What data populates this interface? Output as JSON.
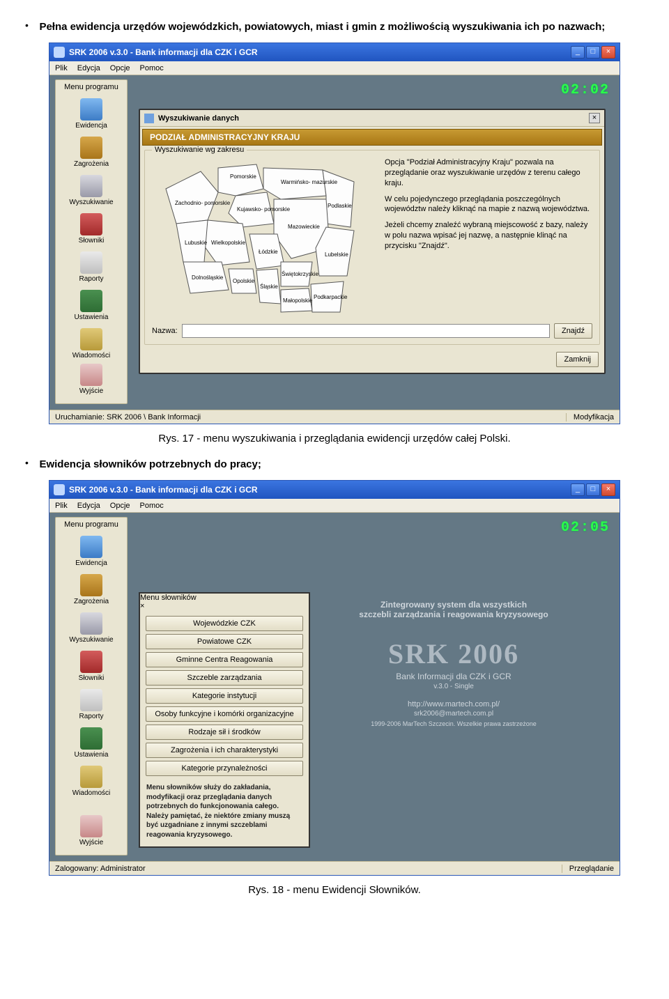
{
  "bullets": {
    "b1": "Pełna ewidencja urzędów wojewódzkich, powiatowych, miast i gmin z możliwością wyszukiwania ich po nazwach;",
    "b2": "Ewidencja słowników potrzebnych do pracy;"
  },
  "captions": {
    "c1": "Rys. 17 - menu wyszukiwania i przeglądania ewidencji urzędów całej Polski.",
    "c2": "Rys. 18 - menu Ewidencji Słowników."
  },
  "app": {
    "title": "SRK 2006 v.3.0 - Bank informacji dla CZK i GCR",
    "menus": {
      "m0": "Plik",
      "m1": "Edycja",
      "m2": "Opcje",
      "m3": "Pomoc"
    },
    "winbtn": {
      "min": "_",
      "max": "□",
      "close": "×"
    },
    "sidebar": {
      "header": "Menu programu",
      "items": [
        {
          "label": "Ewidencja"
        },
        {
          "label": "Zagrożenia"
        },
        {
          "label": "Wyszukiwanie"
        },
        {
          "label": "Słowniki"
        },
        {
          "label": "Raporty"
        },
        {
          "label": "Ustawienia"
        },
        {
          "label": "Wiadomości"
        }
      ],
      "exit": "Wyjście"
    }
  },
  "shot1": {
    "clock": "02:02",
    "status_left": "Uruchamianie: SRK 2006 \\ Bank Informacji",
    "status_right": "Modyfikacja",
    "dialog": {
      "title": "Wyszukiwanie danych",
      "ribbon": "PODZIAŁ ADMINISTRACYJNY KRAJU",
      "group_legend": "Wyszukiwanie wg zakresu",
      "regions": {
        "r1": "Pomorskie",
        "r2": "Warmińsko-\nmazurskie",
        "r3": "Zachodnio-\npomorskie",
        "r4": "Kujawsko-\npomorskie",
        "r5": "Podlaskie",
        "r6": "Mazowieckie",
        "r7": "Wielkopolskie",
        "r8": "Lubuskie",
        "r9": "Łódzkie",
        "r10": "Lubelskie",
        "r11": "Dolnośląskie",
        "r12": "Opolskie",
        "r13": "Śląskie",
        "r14": "Świętokrzyskie",
        "r15": "Małopolskie",
        "r16": "Podkarpackie"
      },
      "info": {
        "p1": "Opcja \"Podział Administracyjny Kraju\" pozwala na przeglądanie oraz wyszukiwanie urzędów z terenu całego kraju.",
        "p2": "W celu pojedynczego przeglądania poszczególnych województw należy kliknąć na mapie z nazwą województwa.",
        "p3": "Jeżeli chcemy znaleźć wybraną miejscowość z bazy, należy w polu nazwa wpisać jej nazwę, a następnie klinąć na przycisku \"Znajdź\"."
      },
      "name_label": "Nazwa:",
      "find": "Znajdź",
      "close": "Zamknij"
    }
  },
  "shot2": {
    "clock": "02:05",
    "status_left": "Zalogowany: Administrator",
    "status_right": "Przeglądanie",
    "bg": {
      "line1a": "Zintegrowany system dla wszystkich",
      "line1b": "szczebli zarządzania i reagowania kryzysowego",
      "brand": "SRK 2006",
      "sub": "Bank Informacji dla CZK i GCR",
      "tiny": "v.3.0 - Single",
      "url1": "http://www.martech.com.pl/",
      "url2": "srk2006@martech.com.pl",
      "copy": "1999-2006 MarTech Szczecin. Wszelkie prawa zastrzeżone"
    },
    "dialog": {
      "title": "Menu słowników",
      "buttons": {
        "b0": "Wojewódzkie CZK",
        "b1": "Powiatowe CZK",
        "b2": "Gminne Centra Reagowania",
        "b3": "Szczeble zarządzania",
        "b4": "Kategorie instytucji",
        "b5": "Osoby funkcyjne i komórki organizacyjne",
        "b6": "Rodzaje sił i środków",
        "b7": "Zagrożenia i ich charakterystyki",
        "b8": "Kategorie przynależności"
      },
      "help": "Menu słowników służy do zakładania, modyfikacji oraz przeglądania danych potrzebnych do funkcjonowania całego. Należy pamiętać, że niektóre zmiany muszą być uzgadniane z innymi szczeblami reagowania kryzysowego."
    }
  }
}
